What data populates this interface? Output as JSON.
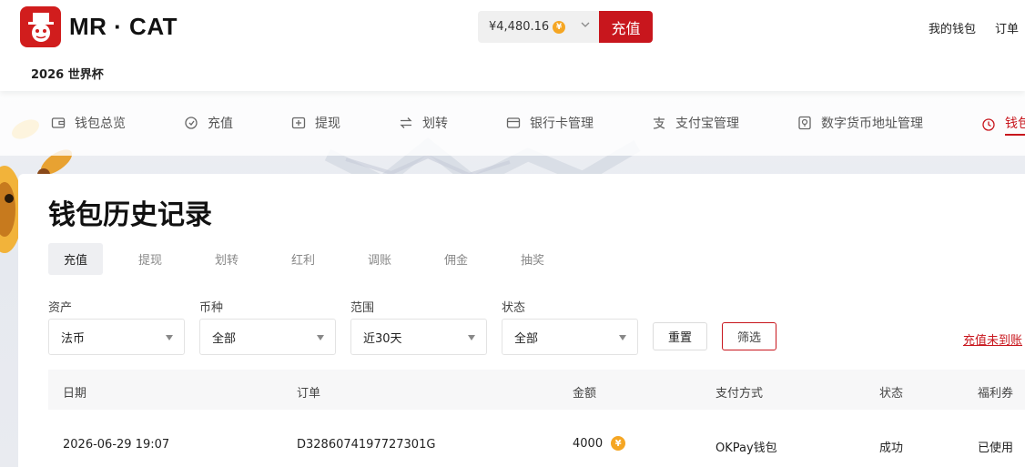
{
  "header": {
    "logo_text": "MR · CAT",
    "sub_title": "2026 世界杯",
    "balance": "¥4,480.16",
    "coin_glyph": "¥",
    "recharge_label": "充值",
    "links": [
      "我的钱包",
      "订单"
    ]
  },
  "nav": {
    "items": [
      {
        "label": "钱包总览",
        "icon": "wallet-icon"
      },
      {
        "label": "充值",
        "icon": "recharge-icon"
      },
      {
        "label": "提现",
        "icon": "withdraw-icon"
      },
      {
        "label": "划转",
        "icon": "transfer-icon"
      },
      {
        "label": "银行卡管理",
        "icon": "bank-card-icon"
      },
      {
        "label": "支付宝管理",
        "icon": "alipay-icon"
      },
      {
        "label": "数字货币地址管理",
        "icon": "crypto-address-icon"
      },
      {
        "label": "钱包",
        "icon": "clock-icon",
        "active": true
      }
    ]
  },
  "main": {
    "title": "钱包历史记录",
    "tabs": [
      "充值",
      "提现",
      "划转",
      "红利",
      "调账",
      "佣金",
      "抽奖"
    ],
    "active_tab": "充值",
    "filters": [
      {
        "label": "资产",
        "value": "法币"
      },
      {
        "label": "币种",
        "value": "全部"
      },
      {
        "label": "范围",
        "value": "近30天"
      },
      {
        "label": "状态",
        "value": "全部"
      }
    ],
    "reset_label": "重置",
    "filter_label": "筛选",
    "unarrived_link": "充值未到账"
  },
  "table": {
    "columns": [
      "日期",
      "订单",
      "金额",
      "支付方式",
      "状态",
      "福利券"
    ],
    "rows": [
      {
        "date": "2026-06-29 19:07",
        "order": "D3286074197727301G",
        "amount": "4000",
        "method": "OKPay钱包",
        "status": "成功",
        "coupon": "已使用"
      }
    ]
  },
  "colors": {
    "brand_red": "#c8161d",
    "coin_gold": "#f5a623"
  }
}
